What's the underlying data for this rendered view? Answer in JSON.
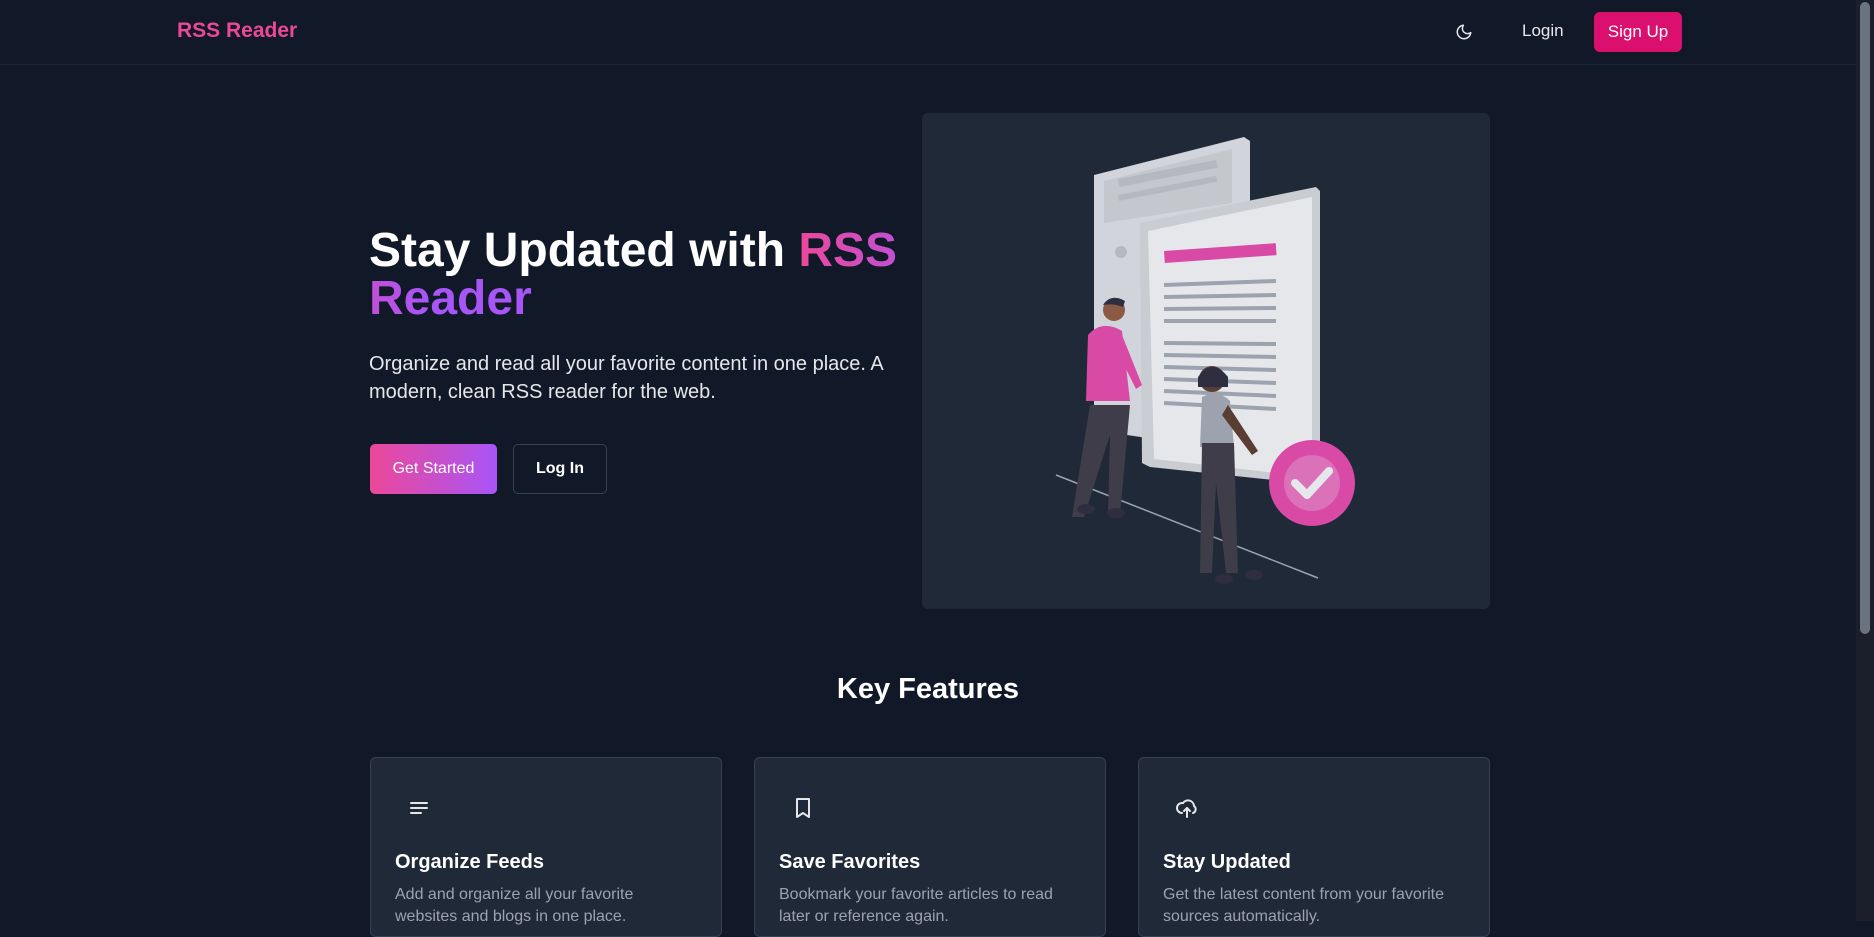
{
  "header": {
    "brand": "RSS Reader",
    "theme_icon": "moon-icon",
    "login_label": "Login",
    "signup_label": "Sign Up"
  },
  "hero": {
    "title_plain": "Stay Updated with ",
    "title_accent": "RSS Reader",
    "subtitle": "Organize and read all your favorite content in one place. A modern, clean RSS reader for the web.",
    "primary_button": "Get Started",
    "secondary_button": "Log In"
  },
  "features": {
    "heading": "Key Features",
    "items": [
      {
        "icon": "lines-icon",
        "title": "Organize Feeds",
        "description": "Add and organize all your favorite websites and blogs in one place."
      },
      {
        "icon": "bookmark-icon",
        "title": "Save Favorites",
        "description": "Bookmark your favorite articles to read later or reference again."
      },
      {
        "icon": "cloud-upload-icon",
        "title": "Stay Updated",
        "description": "Get the latest content from your favorite sources automatically."
      }
    ]
  },
  "colors": {
    "background": "#111827",
    "card": "#1f2937",
    "accent_pink": "#ec4899",
    "accent_purple": "#a855f7",
    "signup": "#db0f6e"
  }
}
